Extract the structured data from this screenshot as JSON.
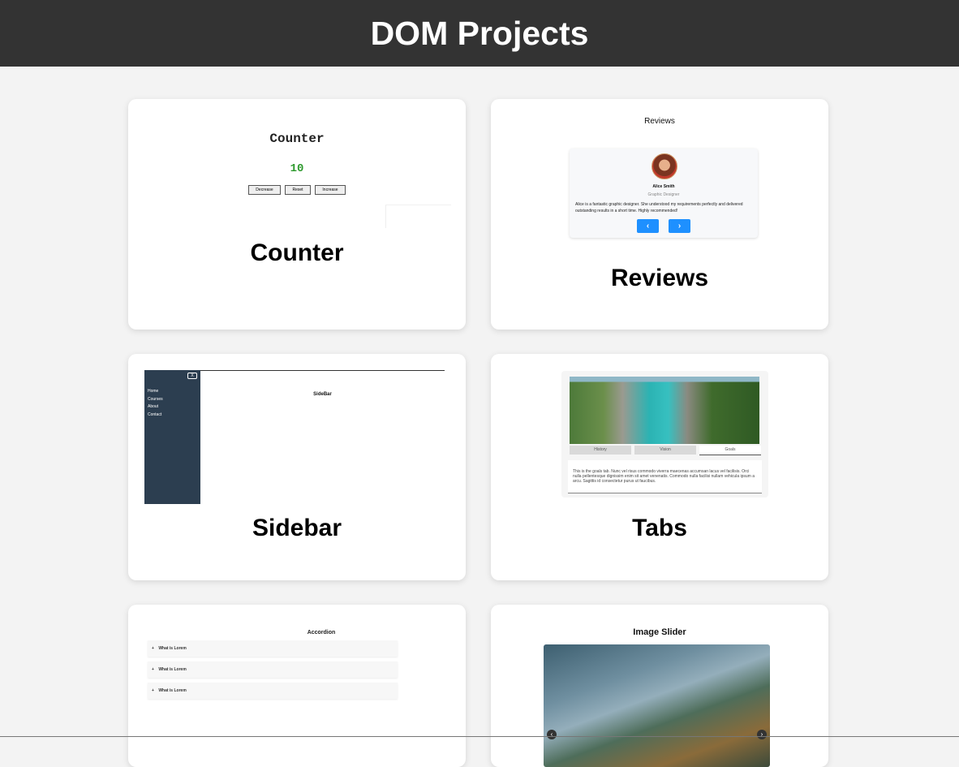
{
  "header": {
    "title": "DOM Projects"
  },
  "cards": [
    {
      "title": "Counter",
      "preview": {
        "heading": "Counter",
        "value": "10",
        "buttons": [
          "Decrease",
          "Reset",
          "Increase"
        ]
      }
    },
    {
      "title": "Reviews",
      "preview": {
        "heading": "Reviews",
        "name": "Alice Smith",
        "job": "Graphic Designer",
        "text": "Alice is a fantastic graphic designer. She understood my requirements perfectly and delivered outstanding results in a short time. Highly recommended!",
        "prev_glyph": "‹",
        "next_glyph": "›"
      }
    },
    {
      "title": "Sidebar",
      "preview": {
        "close_label": "X",
        "links": [
          "Home",
          "Courses",
          "About",
          "Contact"
        ],
        "heading": "SideBar"
      }
    },
    {
      "title": "Tabs",
      "preview": {
        "tabs": [
          "History",
          "Vision",
          "Goals"
        ],
        "active_tab": "Goals",
        "content": "This is the goals tab. Nunc vel risus commodo viverra maecenas accumsan lacus vel facilisis. Orci nulla pellentesque dignissim enim sit amet venenatis. Commodo nulla facilisi nullam vehicula ipsum a arcu. Sagittis id consectetur purus ut faucibus."
      }
    },
    {
      "title": "Accordion",
      "preview": {
        "heading": "Accordion",
        "items": [
          "What is Lorem",
          "What is Lorem",
          "What is Lorem"
        ],
        "toggle_glyph": "+"
      }
    },
    {
      "title": "Image Slider",
      "preview": {
        "heading": "Image Slider",
        "prev_glyph": "‹",
        "next_glyph": "›"
      }
    }
  ],
  "colors": {
    "header_bg": "#333333",
    "page_bg": "#f3f3f3",
    "accent_blue": "#1e90ff",
    "counter_green": "#2e9a2e",
    "sidebar_bg": "#2c3e50"
  }
}
